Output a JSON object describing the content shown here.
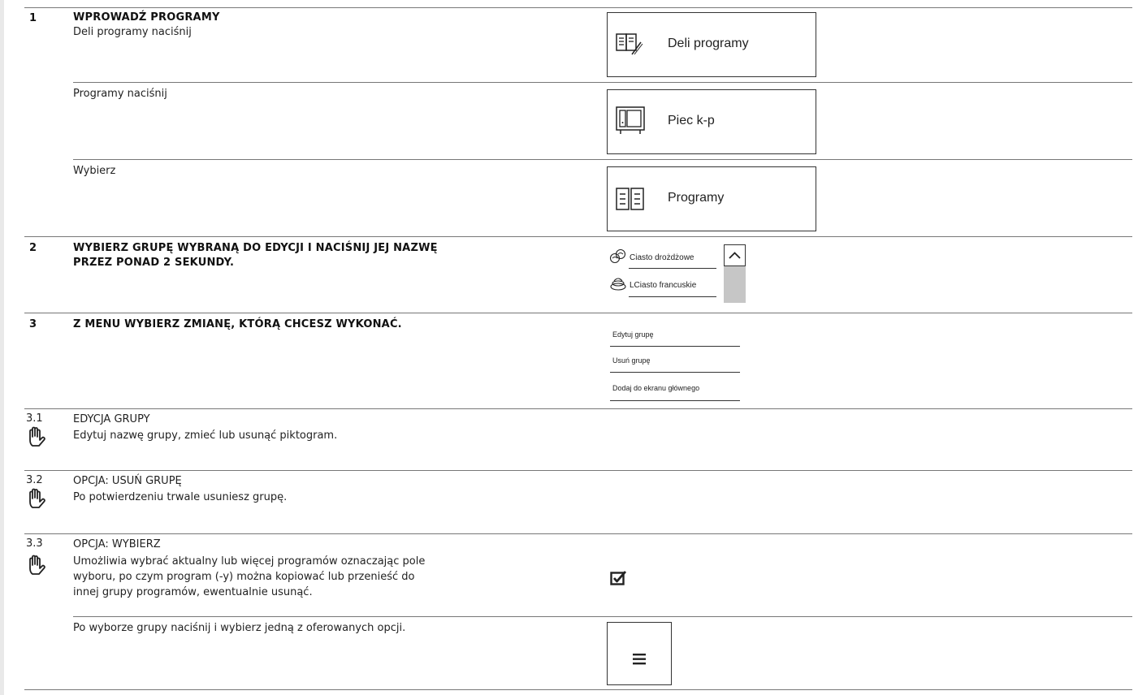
{
  "steps": {
    "s1": {
      "num": "1",
      "title": "WPROWADŹ PROGRAMY",
      "rows": [
        {
          "text": "Deli programy naciśnij",
          "button": "Deli programy",
          "icon": "book-pencil-icon"
        },
        {
          "text": "Programy naciśnij",
          "button": "Piec k-p",
          "icon": "oven-icon"
        },
        {
          "text": "Wybierz",
          "button": "Programy",
          "icon": "list-grid-icon"
        }
      ]
    },
    "s2": {
      "num": "2",
      "title_line1": "WYBIERZ GRUPĘ WYBRANĄ DO EDYCJI I NACIŚNIJ JEJ NAZWĘ",
      "title_line2": "PRZEZ PONAD 2 SEKUNDY.",
      "list": [
        {
          "label": "Ciasto drożdżowe",
          "icon": "bread-icon"
        },
        {
          "label": "LCiasto francuskie",
          "icon": "pastry-icon"
        }
      ]
    },
    "s3": {
      "num": "3",
      "title": "Z MENU WYBIERZ ZMIANĘ, KTÓRĄ CHCESZ WYKONAĆ.",
      "menu": [
        "Edytuj grupę",
        "Usuń grupę",
        "Dodaj do ekranu głównego"
      ]
    },
    "s31": {
      "num": "3.1",
      "title": "EDYCJA GRUPY",
      "text": "Edytuj nazwę grupy, zmieć lub usunąć piktogram."
    },
    "s32": {
      "num": "3.2",
      "title": "OPCJA: USUŃ GRUPĘ",
      "text": "Po potwierdzeniu trwale usuniesz grupę."
    },
    "s33": {
      "num": "3.3",
      "title": "OPCJA: WYBIERZ",
      "lines": [
        "Umożliwia wybrać aktualny lub więcej programów oznaczając pole",
        "wyboru, po czym program (-y) można kopiować lub przenieść do",
        "innej grupy programów, ewentualnie usunąć."
      ],
      "extra": "Po wyborze grupy naciśnij i wybierz jedną z oferowanych opcji."
    }
  },
  "icons": {
    "hand": "hand-stop-icon",
    "checkbox": "checkbox-icon",
    "menu": "hamburger-menu-icon"
  }
}
